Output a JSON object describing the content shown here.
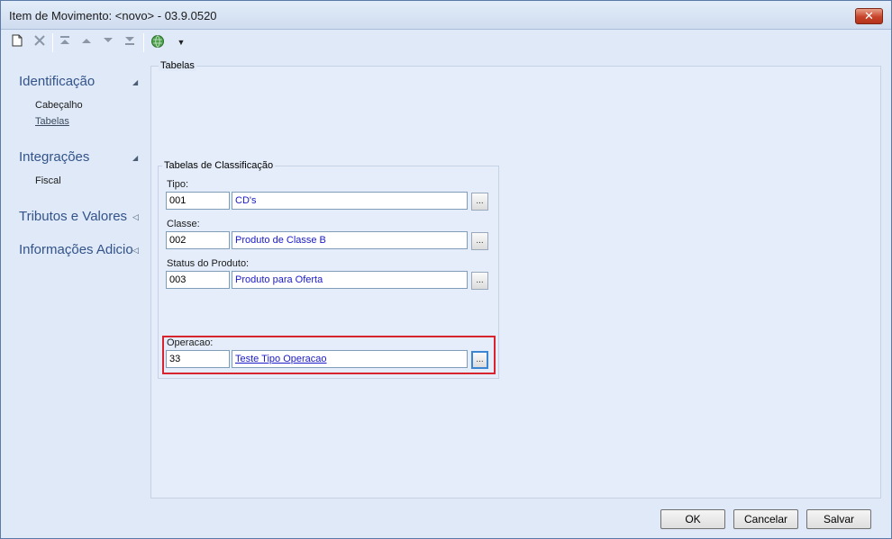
{
  "window": {
    "title": "Item de Movimento: <novo> - 03.9.0520",
    "close_glyph": "✕"
  },
  "toolbar": {
    "icons": [
      "new-document-icon",
      "delete-icon",
      "first-record-icon",
      "previous-record-icon",
      "next-record-icon",
      "last-record-icon",
      "globe-icon",
      "dropdown-arrow-icon"
    ]
  },
  "sidebar": {
    "sections": [
      {
        "label": "Identificação",
        "items": [
          "Cabeçalho",
          "Tabelas"
        ]
      },
      {
        "label": "Integrações",
        "items": [
          "Fiscal"
        ]
      },
      {
        "label": "Tributos e Valores",
        "items": []
      },
      {
        "label": "Informações Adicio",
        "items": []
      }
    ]
  },
  "main": {
    "panel_label": "Tabelas",
    "group_label": "Tabelas de Classificação",
    "fields": [
      {
        "label": "Tipo:",
        "code": "001",
        "description": "CD's"
      },
      {
        "label": "Classe:",
        "code": "002",
        "description": "Produto de Classe B"
      },
      {
        "label": "Status do Produto:",
        "code": "003",
        "description": "Produto para Oferta"
      },
      {
        "label": "Operacao:",
        "code": "33",
        "description": "Teste Tipo Operacao"
      }
    ],
    "lookup_label": "..."
  },
  "footer": {
    "ok_label": "OK",
    "cancel_label": "Cancelar",
    "save_label": "Salvar"
  },
  "colors": {
    "highlight_border": "#d8242f",
    "link_text": "#1a1ac8",
    "section_heading": "#33538a"
  }
}
